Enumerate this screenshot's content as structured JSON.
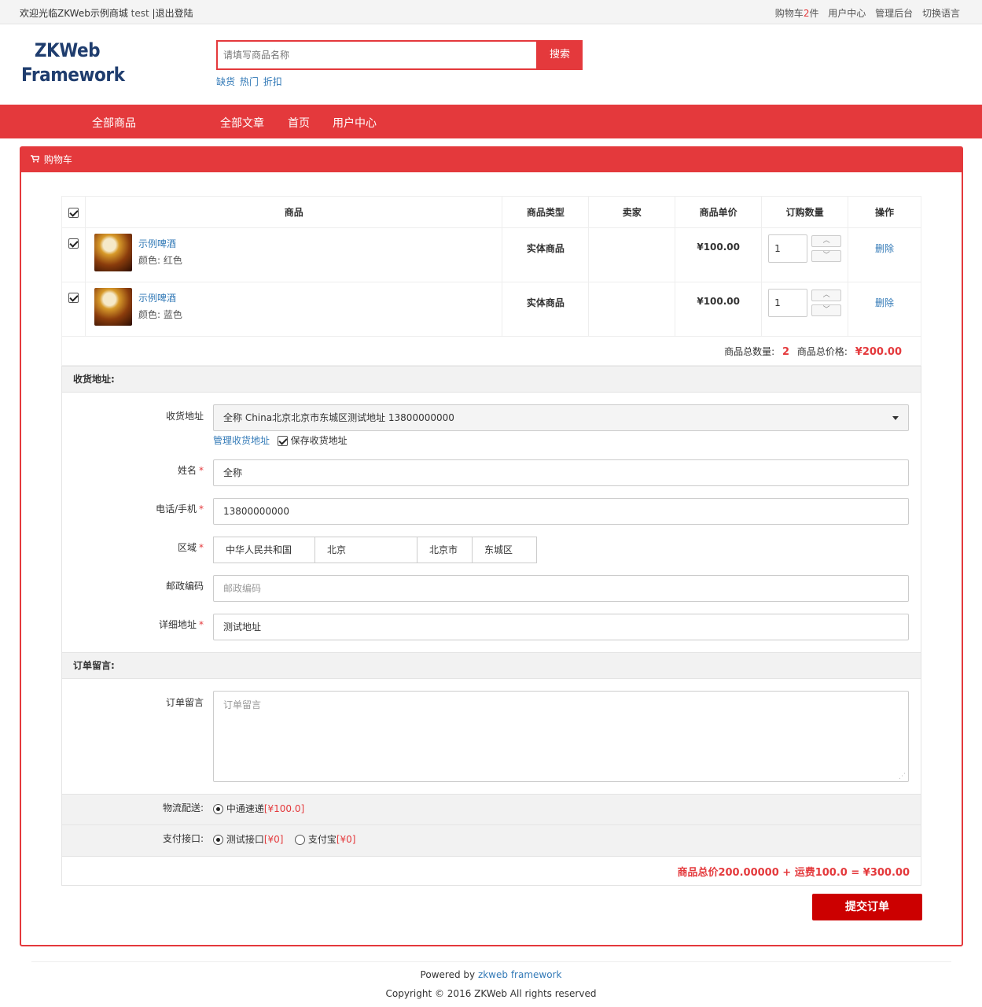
{
  "topbar": {
    "welcome": "欢迎光临ZKWeb示例商城",
    "username": "test",
    "separator": "|",
    "logout": "退出登陆",
    "cart_prefix": "购物车",
    "cart_count": "2",
    "cart_suffix": "件",
    "user_center": "用户中心",
    "admin": "管理后台",
    "language": "切换语言"
  },
  "logo": {
    "line1": "ZKWeb",
    "line2": "Framework"
  },
  "search": {
    "placeholder": "请填写商品名称",
    "button": "搜索"
  },
  "hot_words": [
    "缺货",
    "热门",
    "折扣"
  ],
  "nav": {
    "all_products": "全部商品",
    "all_articles": "全部文章",
    "home": "首页",
    "user_center": "用户中心"
  },
  "colors": {
    "brand_red": "#e4393c",
    "submit_red": "#cc0000",
    "link_blue": "#337ab7"
  },
  "panel": {
    "title": "购物车",
    "icon": "shopping-cart-icon"
  },
  "table": {
    "headers": {
      "product": "商品",
      "type": "商品类型",
      "seller": "卖家",
      "unit_price": "商品单价",
      "quantity": "订购数量",
      "action": "操作"
    },
    "rows": [
      {
        "name": "示例啤酒",
        "attr": "颜色: 红色",
        "type": "实体商品",
        "seller": "",
        "price": "¥100.00",
        "qty": "1",
        "action": "删除"
      },
      {
        "name": "示例啤酒",
        "attr": "颜色: 蓝色",
        "type": "实体商品",
        "seller": "",
        "price": "¥100.00",
        "qty": "1",
        "action": "删除"
      }
    ]
  },
  "summary": {
    "count_label": "商品总数量:",
    "count": "2",
    "price_label": "商品总价格:",
    "price": "¥200.00"
  },
  "address": {
    "section_title": "收货地址:",
    "address_label": "收货地址",
    "address_selected": "全称 China北京北京市东城区测试地址 13800000000",
    "manage_link": "管理收货地址",
    "save_label": "保存收货地址",
    "name_label": "姓名",
    "name_value": "全称",
    "phone_label": "电话/手机",
    "phone_value": "13800000000",
    "region_label": "区域",
    "region": [
      "中华人民共和国",
      "北京",
      "北京市",
      "东城区"
    ],
    "zip_label": "邮政编码",
    "zip_placeholder": "邮政编码",
    "detail_label": "详细地址",
    "detail_value": "测试地址",
    "required_mark": "*"
  },
  "comment": {
    "section_title": "订单留言:",
    "label": "订单留言",
    "placeholder": "订单留言"
  },
  "logistics": {
    "label": "物流配送:",
    "option": "中通速递",
    "price": "[¥100.0]"
  },
  "payment": {
    "label": "支付接口:",
    "options": [
      {
        "name": "测试接口",
        "price": "[¥0]"
      },
      {
        "name": "支付宝",
        "price": "[¥0]"
      }
    ]
  },
  "total": "商品总价200.00000 + 运费100.0 = ¥300.00",
  "submit": "提交订单",
  "footer": {
    "powered_prefix": "Powered by",
    "powered_link": "zkweb framework",
    "copyright": "Copyright © 2016 ZKWeb All rights reserved"
  }
}
